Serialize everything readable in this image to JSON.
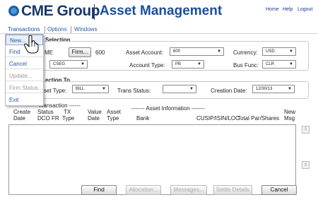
{
  "header": {
    "brand": "CME Group",
    "app_title": "Asset Management",
    "links": {
      "home": "Home",
      "help": "Help",
      "logout": "Logout"
    }
  },
  "menubar": {
    "items": [
      "Transactions",
      "Options",
      "Windows"
    ]
  },
  "transactions_menu": {
    "items": [
      {
        "label": "New...",
        "enabled": true
      },
      {
        "label": "Find",
        "enabled": true
      },
      {
        "label": "Cancel",
        "enabled": true
      },
      {
        "label": "Update...",
        "enabled": false
      },
      {
        "label": "Firm Status...",
        "enabled": false
      },
      {
        "label": "Exit",
        "enabled": true
      }
    ]
  },
  "selection": {
    "title": "Selection",
    "exchange_partial": "ME",
    "firm_button": "Firm...",
    "firm_value": "600",
    "seg_value": "CSEG",
    "asset_account_label": "Asset Account:",
    "asset_account_value": "600",
    "account_type_label": "Account Type:",
    "account_type_value": "PB",
    "currency_label": "Currency:",
    "currency_value": "USD",
    "bus_func_label": "Bus Func:",
    "bus_func_value": "CLR"
  },
  "selection_to": {
    "title": "ection To",
    "asset_type_label": "set Type:",
    "asset_type_value": "BILL",
    "trans_status_label": "Trans Status:",
    "trans_status_value": "",
    "creation_date_label": "Creation Date:",
    "creation_date_value": "12/30/13"
  },
  "grid": {
    "group_transaction": "------ Transaction ------",
    "group_asset": "------- Asset Information -------",
    "columns": {
      "create_date": [
        "Create",
        "Date"
      ],
      "status": [
        "Status",
        "DCO FR"
      ],
      "tx_type": [
        "TX",
        "Type"
      ],
      "value_date": [
        "Value",
        "Date"
      ],
      "asset_type": [
        "Asset",
        "Type"
      ],
      "bank": "Bank",
      "cusip": "CUSIP/ISIN/LOC",
      "total_par": "Total Par/Shares",
      "new_msg": [
        "New",
        "Msg"
      ]
    },
    "scroll_up": "⇑",
    "scroll_down": "⇓"
  },
  "footer_buttons": {
    "find": "Find",
    "allocation": "Allocation...",
    "messages": "Messages...",
    "settle_details": "Settle Details",
    "cancel": "Cancel"
  }
}
